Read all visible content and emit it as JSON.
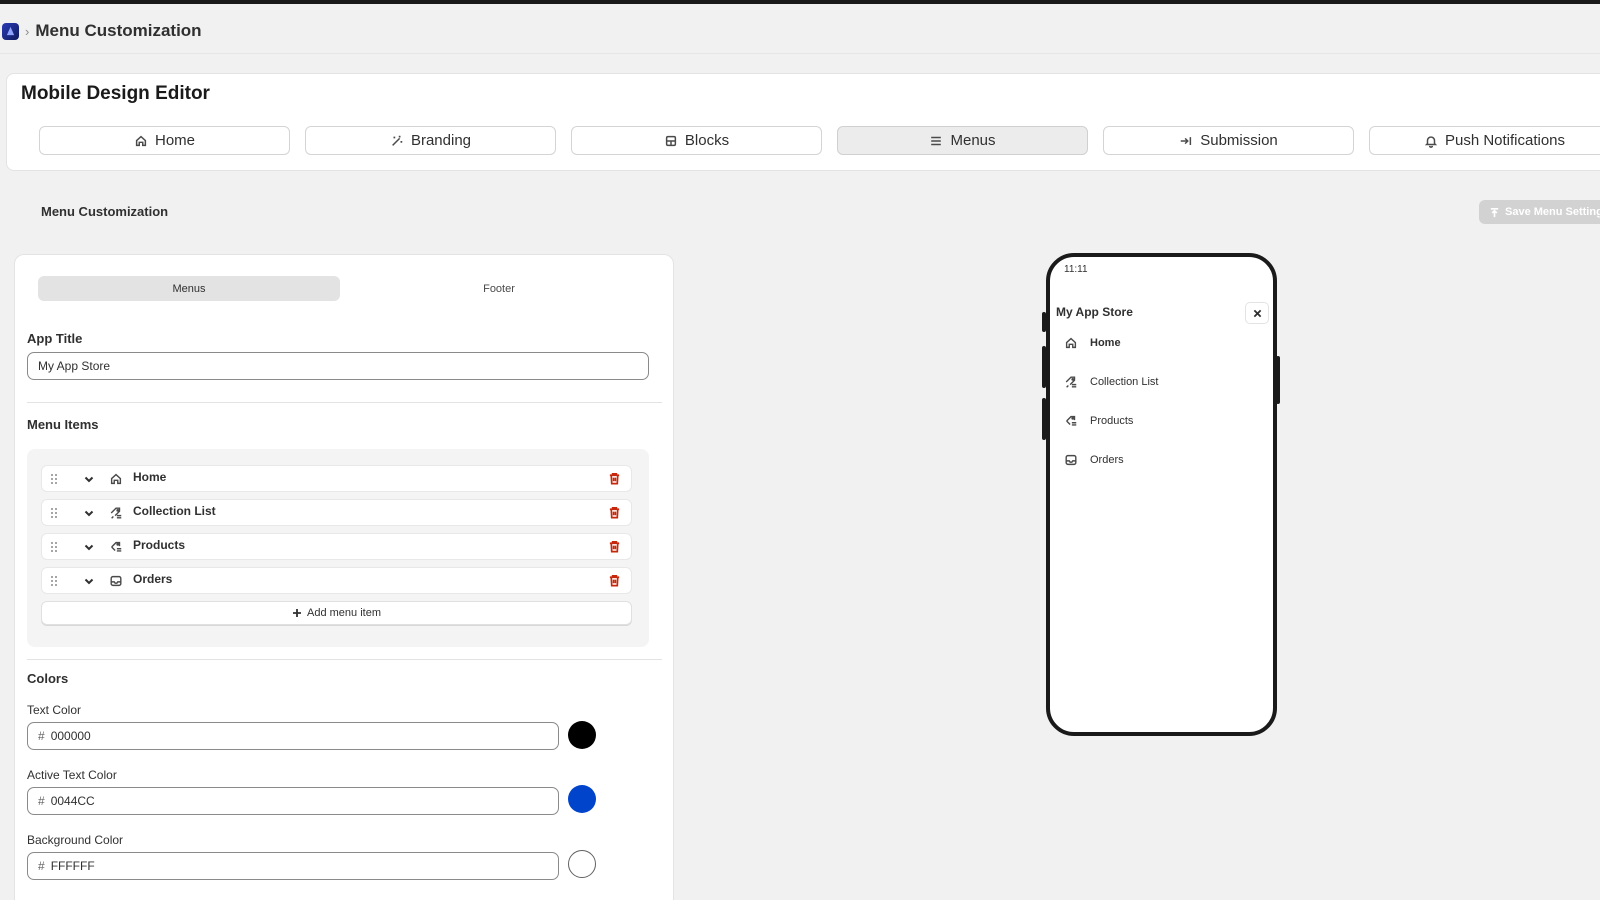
{
  "breadcrumb": {
    "icon": "app-logo-icon",
    "separator": "›",
    "title": "Menu Customization"
  },
  "editor": {
    "title": "Mobile Design Editor",
    "tabs": [
      {
        "label": "Home",
        "icon": "home-icon",
        "active": false
      },
      {
        "label": "Branding",
        "icon": "magic-wand-icon",
        "active": false
      },
      {
        "label": "Blocks",
        "icon": "blocks-icon",
        "active": false
      },
      {
        "label": "Menus",
        "icon": "menu-icon",
        "active": true
      },
      {
        "label": "Submission",
        "icon": "submit-arrow-icon",
        "active": false
      },
      {
        "label": "Push Notifications",
        "icon": "bell-icon",
        "active": false
      }
    ]
  },
  "section": {
    "title": "Menu Customization",
    "save_label": "Save Menu Settings"
  },
  "panel": {
    "segments": [
      {
        "label": "Menus",
        "active": true
      },
      {
        "label": "Footer",
        "active": false
      }
    ],
    "app_title_label": "App Title",
    "app_title_value": "My App Store",
    "menu_items_label": "Menu Items",
    "menu_items": [
      {
        "label": "Home",
        "icon": "home-icon"
      },
      {
        "label": "Collection List",
        "icon": "collection-icon"
      },
      {
        "label": "Products",
        "icon": "product-icon"
      },
      {
        "label": "Orders",
        "icon": "inbox-icon"
      }
    ],
    "add_item_label": "Add menu item",
    "colors_label": "Colors",
    "colors": [
      {
        "label": "Text Color",
        "value": "000000",
        "swatch": "#000000"
      },
      {
        "label": "Active Text Color",
        "value": "0044CC",
        "swatch": "#0044CC"
      },
      {
        "label": "Background Color",
        "value": "FFFFFF",
        "swatch": "#FFFFFF"
      }
    ],
    "hash": "#"
  },
  "preview": {
    "time": "11:11",
    "title": "My App Store",
    "items": [
      {
        "label": "Home",
        "icon": "home-icon",
        "active": true
      },
      {
        "label": "Collection List",
        "icon": "collection-icon",
        "active": false
      },
      {
        "label": "Products",
        "icon": "product-icon",
        "active": false
      },
      {
        "label": "Orders",
        "icon": "inbox-icon",
        "active": false
      }
    ]
  }
}
